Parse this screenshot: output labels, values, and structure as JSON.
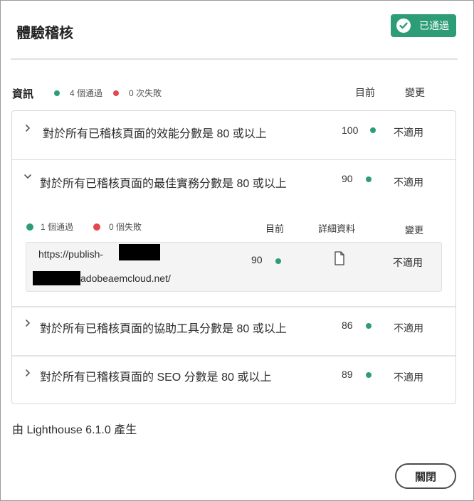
{
  "dialog": {
    "title": "體驗稽核",
    "badge_label": "已通過",
    "section_label": "資訊",
    "summary": {
      "passed": "4 個通過",
      "failed": "0 次失敗"
    },
    "columns": {
      "current": "目前",
      "change": "變更"
    },
    "rows": [
      {
        "title": "對於所有已稽核頁面的效能分數是 80 或以上",
        "score": "100",
        "change": "不適用",
        "expanded": false
      },
      {
        "title": "對於所有已稽核頁面的最佳實務分數是 80 或以上",
        "score": "90",
        "change": "不適用",
        "expanded": true
      },
      {
        "title": "對於所有已稽核頁面的協助工具分數是 80 或以上",
        "score": "86",
        "change": "不適用",
        "expanded": false
      },
      {
        "title": "對於所有已稽核頁面的 SEO 分數是 80 或以上",
        "score": "89",
        "change": "不適用",
        "expanded": false
      }
    ],
    "detail": {
      "passed": "1 個通過",
      "failed": "0 個失敗",
      "columns": {
        "current": "目前",
        "details": "詳細資料",
        "change": "變更"
      },
      "url_line1": "https://publish-",
      "url_line2": "adobeaemcloud.net/",
      "score": "90",
      "change": "不適用",
      "details_icon": "document-icon"
    },
    "footer": "由 Lighthouse 6.1.0 產生",
    "close_label": "關閉"
  },
  "colors": {
    "pass_green": "#2d9d78",
    "fail_red": "#e34850"
  }
}
